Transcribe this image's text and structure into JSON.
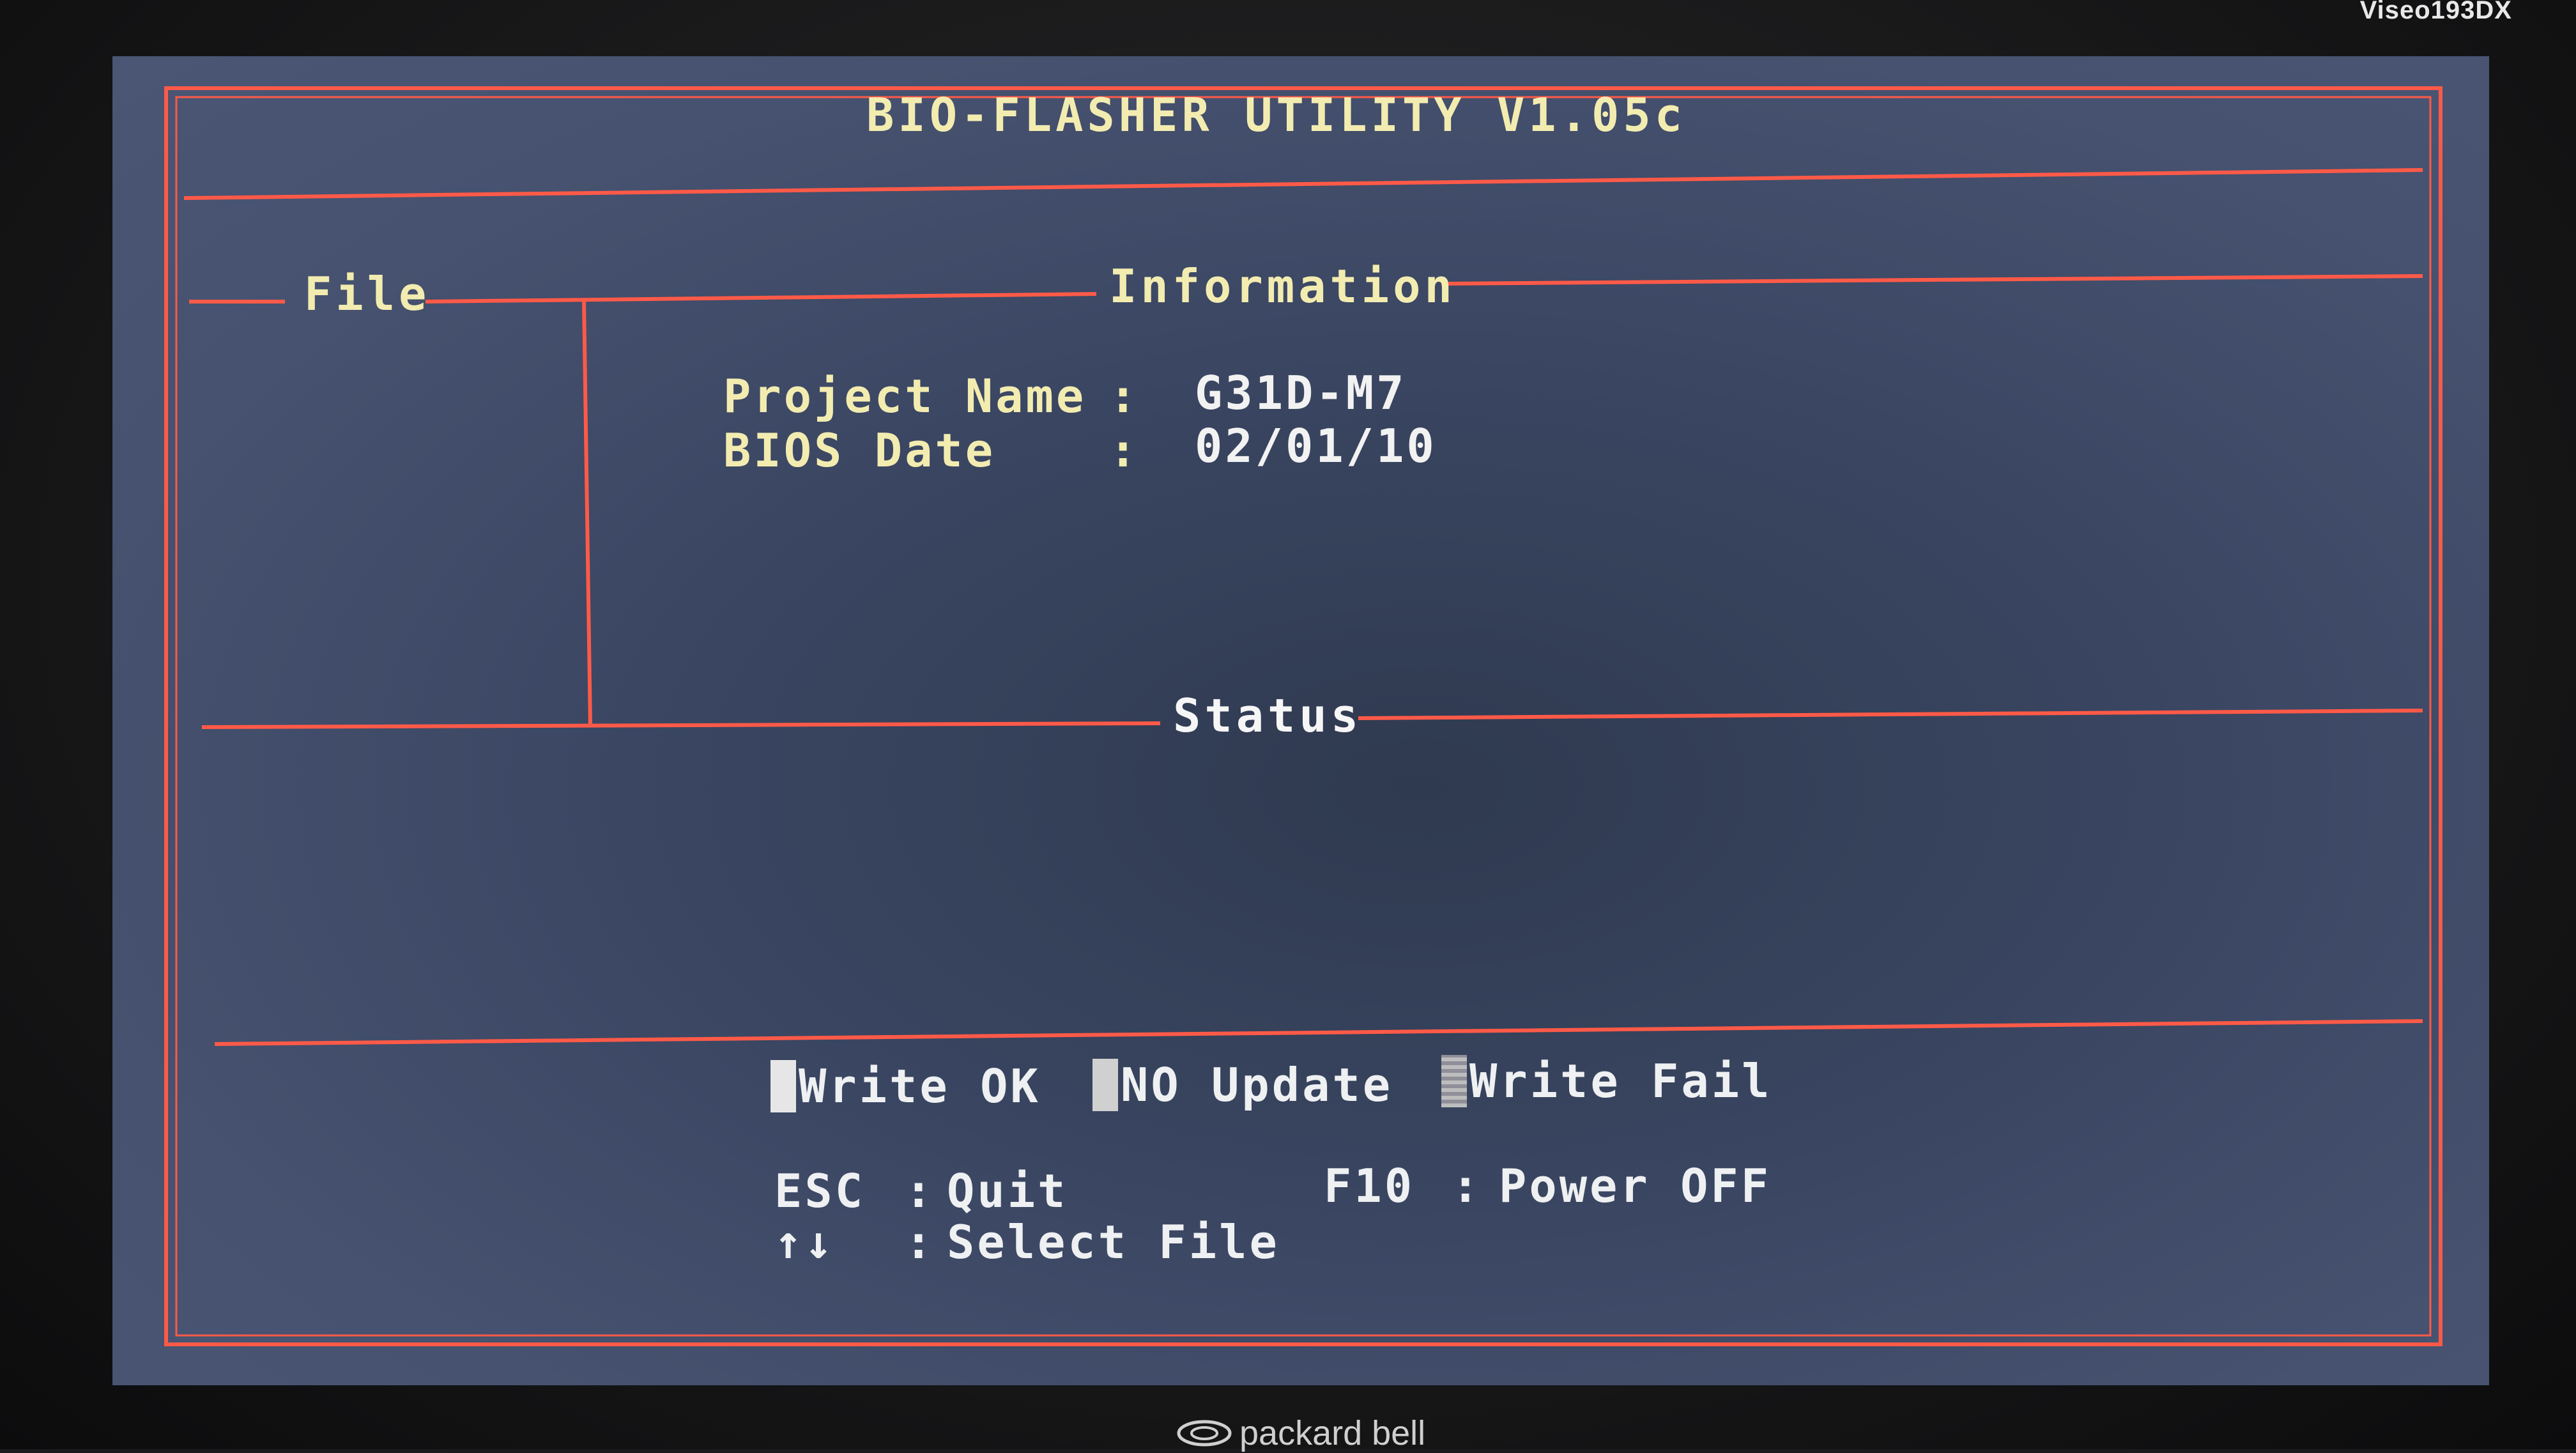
{
  "monitor": {
    "model": "Viseo193DX",
    "brand": "packard bell"
  },
  "bios": {
    "title": "BIO-FLASHER UTILITY V1.05c",
    "sections": {
      "file": "File",
      "information": "Information",
      "status": "Status"
    },
    "info": [
      {
        "label": "Project Name",
        "sep": ":",
        "value": "G31D-M7"
      },
      {
        "label": "BIOS Date",
        "sep": ":",
        "value": "02/01/10"
      }
    ],
    "legend": [
      {
        "label": "Write OK"
      },
      {
        "label": "NO Update"
      },
      {
        "label": "Write Fail"
      }
    ],
    "keys": [
      {
        "key": "ESC",
        "sep": ":",
        "action": "Quit"
      },
      {
        "key": "F10",
        "sep": ":",
        "action": "Power OFF"
      },
      {
        "key": "↑↓",
        "sep": ":",
        "action": "Select File"
      }
    ],
    "colors": {
      "frame": "#ff4a3a",
      "text_yellow": "#f3ecb0",
      "text_white": "#eef0f2",
      "background": "#3b4763"
    }
  }
}
